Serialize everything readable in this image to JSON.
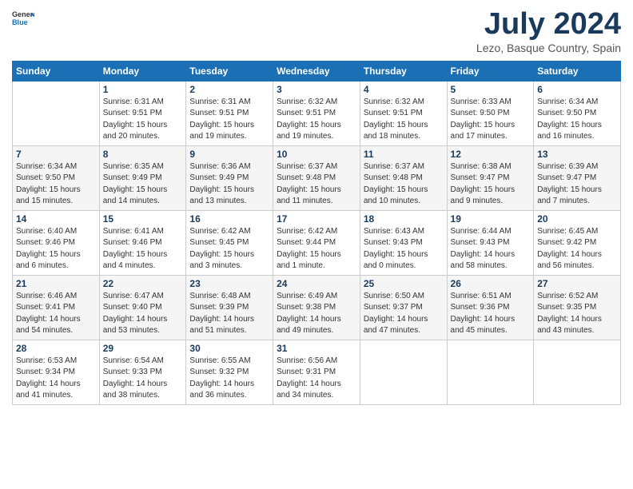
{
  "header": {
    "logo_general": "General",
    "logo_blue": "Blue",
    "title": "July 2024",
    "location": "Lezo, Basque Country, Spain"
  },
  "days_of_week": [
    "Sunday",
    "Monday",
    "Tuesday",
    "Wednesday",
    "Thursday",
    "Friday",
    "Saturday"
  ],
  "weeks": [
    [
      {
        "day": "",
        "info": ""
      },
      {
        "day": "1",
        "info": "Sunrise: 6:31 AM\nSunset: 9:51 PM\nDaylight: 15 hours\nand 20 minutes."
      },
      {
        "day": "2",
        "info": "Sunrise: 6:31 AM\nSunset: 9:51 PM\nDaylight: 15 hours\nand 19 minutes."
      },
      {
        "day": "3",
        "info": "Sunrise: 6:32 AM\nSunset: 9:51 PM\nDaylight: 15 hours\nand 19 minutes."
      },
      {
        "day": "4",
        "info": "Sunrise: 6:32 AM\nSunset: 9:51 PM\nDaylight: 15 hours\nand 18 minutes."
      },
      {
        "day": "5",
        "info": "Sunrise: 6:33 AM\nSunset: 9:50 PM\nDaylight: 15 hours\nand 17 minutes."
      },
      {
        "day": "6",
        "info": "Sunrise: 6:34 AM\nSunset: 9:50 PM\nDaylight: 15 hours\nand 16 minutes."
      }
    ],
    [
      {
        "day": "7",
        "info": "Sunrise: 6:34 AM\nSunset: 9:50 PM\nDaylight: 15 hours\nand 15 minutes."
      },
      {
        "day": "8",
        "info": "Sunrise: 6:35 AM\nSunset: 9:49 PM\nDaylight: 15 hours\nand 14 minutes."
      },
      {
        "day": "9",
        "info": "Sunrise: 6:36 AM\nSunset: 9:49 PM\nDaylight: 15 hours\nand 13 minutes."
      },
      {
        "day": "10",
        "info": "Sunrise: 6:37 AM\nSunset: 9:48 PM\nDaylight: 15 hours\nand 11 minutes."
      },
      {
        "day": "11",
        "info": "Sunrise: 6:37 AM\nSunset: 9:48 PM\nDaylight: 15 hours\nand 10 minutes."
      },
      {
        "day": "12",
        "info": "Sunrise: 6:38 AM\nSunset: 9:47 PM\nDaylight: 15 hours\nand 9 minutes."
      },
      {
        "day": "13",
        "info": "Sunrise: 6:39 AM\nSunset: 9:47 PM\nDaylight: 15 hours\nand 7 minutes."
      }
    ],
    [
      {
        "day": "14",
        "info": "Sunrise: 6:40 AM\nSunset: 9:46 PM\nDaylight: 15 hours\nand 6 minutes."
      },
      {
        "day": "15",
        "info": "Sunrise: 6:41 AM\nSunset: 9:46 PM\nDaylight: 15 hours\nand 4 minutes."
      },
      {
        "day": "16",
        "info": "Sunrise: 6:42 AM\nSunset: 9:45 PM\nDaylight: 15 hours\nand 3 minutes."
      },
      {
        "day": "17",
        "info": "Sunrise: 6:42 AM\nSunset: 9:44 PM\nDaylight: 15 hours\nand 1 minute."
      },
      {
        "day": "18",
        "info": "Sunrise: 6:43 AM\nSunset: 9:43 PM\nDaylight: 15 hours\nand 0 minutes."
      },
      {
        "day": "19",
        "info": "Sunrise: 6:44 AM\nSunset: 9:43 PM\nDaylight: 14 hours\nand 58 minutes."
      },
      {
        "day": "20",
        "info": "Sunrise: 6:45 AM\nSunset: 9:42 PM\nDaylight: 14 hours\nand 56 minutes."
      }
    ],
    [
      {
        "day": "21",
        "info": "Sunrise: 6:46 AM\nSunset: 9:41 PM\nDaylight: 14 hours\nand 54 minutes."
      },
      {
        "day": "22",
        "info": "Sunrise: 6:47 AM\nSunset: 9:40 PM\nDaylight: 14 hours\nand 53 minutes."
      },
      {
        "day": "23",
        "info": "Sunrise: 6:48 AM\nSunset: 9:39 PM\nDaylight: 14 hours\nand 51 minutes."
      },
      {
        "day": "24",
        "info": "Sunrise: 6:49 AM\nSunset: 9:38 PM\nDaylight: 14 hours\nand 49 minutes."
      },
      {
        "day": "25",
        "info": "Sunrise: 6:50 AM\nSunset: 9:37 PM\nDaylight: 14 hours\nand 47 minutes."
      },
      {
        "day": "26",
        "info": "Sunrise: 6:51 AM\nSunset: 9:36 PM\nDaylight: 14 hours\nand 45 minutes."
      },
      {
        "day": "27",
        "info": "Sunrise: 6:52 AM\nSunset: 9:35 PM\nDaylight: 14 hours\nand 43 minutes."
      }
    ],
    [
      {
        "day": "28",
        "info": "Sunrise: 6:53 AM\nSunset: 9:34 PM\nDaylight: 14 hours\nand 41 minutes."
      },
      {
        "day": "29",
        "info": "Sunrise: 6:54 AM\nSunset: 9:33 PM\nDaylight: 14 hours\nand 38 minutes."
      },
      {
        "day": "30",
        "info": "Sunrise: 6:55 AM\nSunset: 9:32 PM\nDaylight: 14 hours\nand 36 minutes."
      },
      {
        "day": "31",
        "info": "Sunrise: 6:56 AM\nSunset: 9:31 PM\nDaylight: 14 hours\nand 34 minutes."
      },
      {
        "day": "",
        "info": ""
      },
      {
        "day": "",
        "info": ""
      },
      {
        "day": "",
        "info": ""
      }
    ]
  ]
}
